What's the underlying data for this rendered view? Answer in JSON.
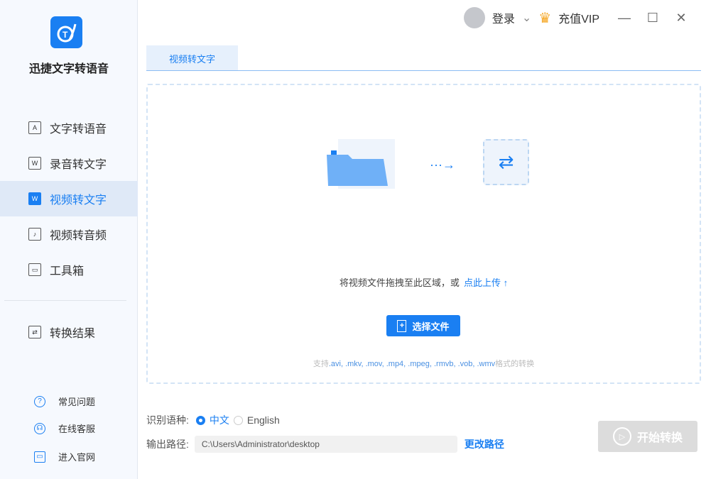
{
  "app": {
    "name": "迅捷文字转语音"
  },
  "sidebar": {
    "items": [
      {
        "label": "文字转语音",
        "icon": "A"
      },
      {
        "label": "录音转文字",
        "icon": "W"
      },
      {
        "label": "视频转文字",
        "icon": "W"
      },
      {
        "label": "视频转音频",
        "icon": "♪"
      },
      {
        "label": "工具箱",
        "icon": "▭"
      }
    ],
    "result": "转换结果",
    "footer": [
      "常见问题",
      "在线客服",
      "进入官网"
    ]
  },
  "header": {
    "login": "登录",
    "vip": "充值VIP"
  },
  "tab": "视频转文字",
  "drop": {
    "hint": "将视频文件拖拽至此区域，或",
    "upload": "点此上传",
    "choose": "选择文件",
    "fmt_prefix": "支持",
    "formats": ".avi, .mkv, .mov, .mp4, .mpeg, .rmvb, .vob, .wmv",
    "fmt_suffix": "格式的转换"
  },
  "settings": {
    "lang_label": "识别语种:",
    "lang_zh": "中文",
    "lang_en": "English",
    "path_label": "输出路径:",
    "path": "C:\\Users\\Administrator\\desktop",
    "change": "更改路径",
    "start": "开始转换"
  }
}
